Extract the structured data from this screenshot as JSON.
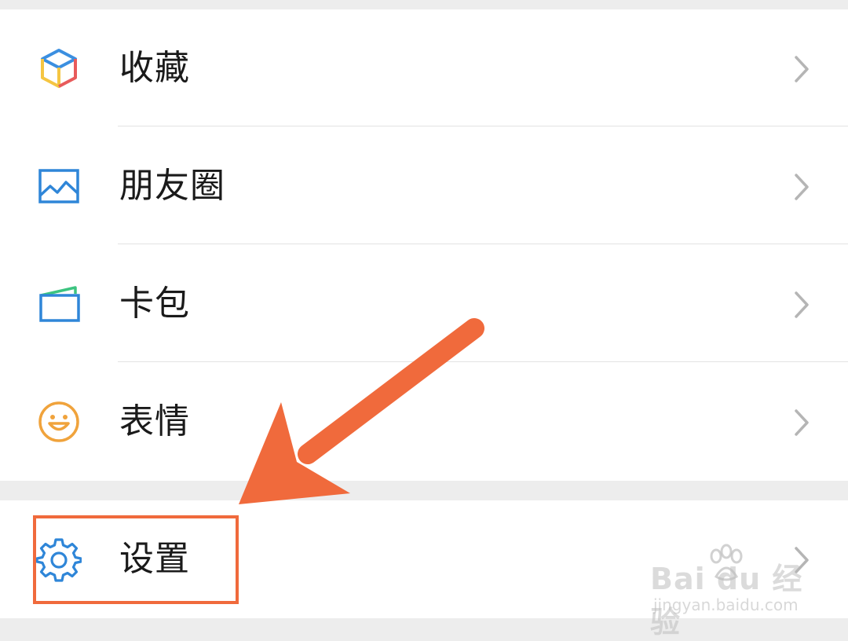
{
  "menu": {
    "group1": [
      {
        "label": "收藏",
        "icon": "favorites-cube-icon"
      },
      {
        "label": "朋友圈",
        "icon": "moments-image-icon"
      },
      {
        "label": "卡包",
        "icon": "card-wallet-icon"
      },
      {
        "label": "表情",
        "icon": "sticker-smiley-icon"
      }
    ],
    "group2": [
      {
        "label": "设置",
        "icon": "settings-gear-icon"
      }
    ]
  },
  "watermark": {
    "brand": "Bai du 经验",
    "url": "jingyan.baidu.com"
  },
  "colors": {
    "annotation": "#f06a3c",
    "favorites_blue": "#3b8fe0",
    "favorites_yellow": "#f5c542",
    "favorites_red": "#e85b5b",
    "moments_blue": "#2f86d8",
    "wallet_blue": "#2f86d8",
    "wallet_green": "#3cc480",
    "sticker_orange": "#f0a33c",
    "settings_blue": "#2f86d8"
  }
}
